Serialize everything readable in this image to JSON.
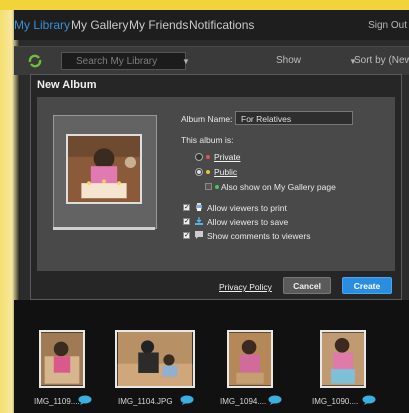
{
  "nav": {
    "items": [
      "My Library",
      "My Gallery",
      "My Friends",
      "Notifications"
    ],
    "sign_out": "Sign Out"
  },
  "toolbar": {
    "search_placeholder": "Search My Library",
    "show_label": "Show",
    "sort_label": "Sort by (Newest)"
  },
  "modal": {
    "title": "New Album",
    "album_name_label": "Album Name:",
    "album_name_value": "For Relatives",
    "visibility_label": "This album is:",
    "private_label": "Private",
    "public_label": "Public",
    "also_show_label": "Also show on My Gallery page",
    "allow_print_label": "Allow viewers to print",
    "allow_save_label": "Allow viewers to save",
    "show_comments_label": "Show comments to viewers",
    "privacy_policy": "Privacy Policy",
    "cancel": "Cancel",
    "create": "Create",
    "colors": {
      "accent": "#2a8de0",
      "private_dot": "#e05060",
      "public_dot": "#f0c040",
      "gallery_dot": "#50c060"
    }
  },
  "thumbnails": [
    {
      "label": "IMG_1109...."
    },
    {
      "label": "IMG_1104.JPG"
    },
    {
      "label": "IMG_1094...."
    },
    {
      "label": "IMG_1090...."
    }
  ]
}
